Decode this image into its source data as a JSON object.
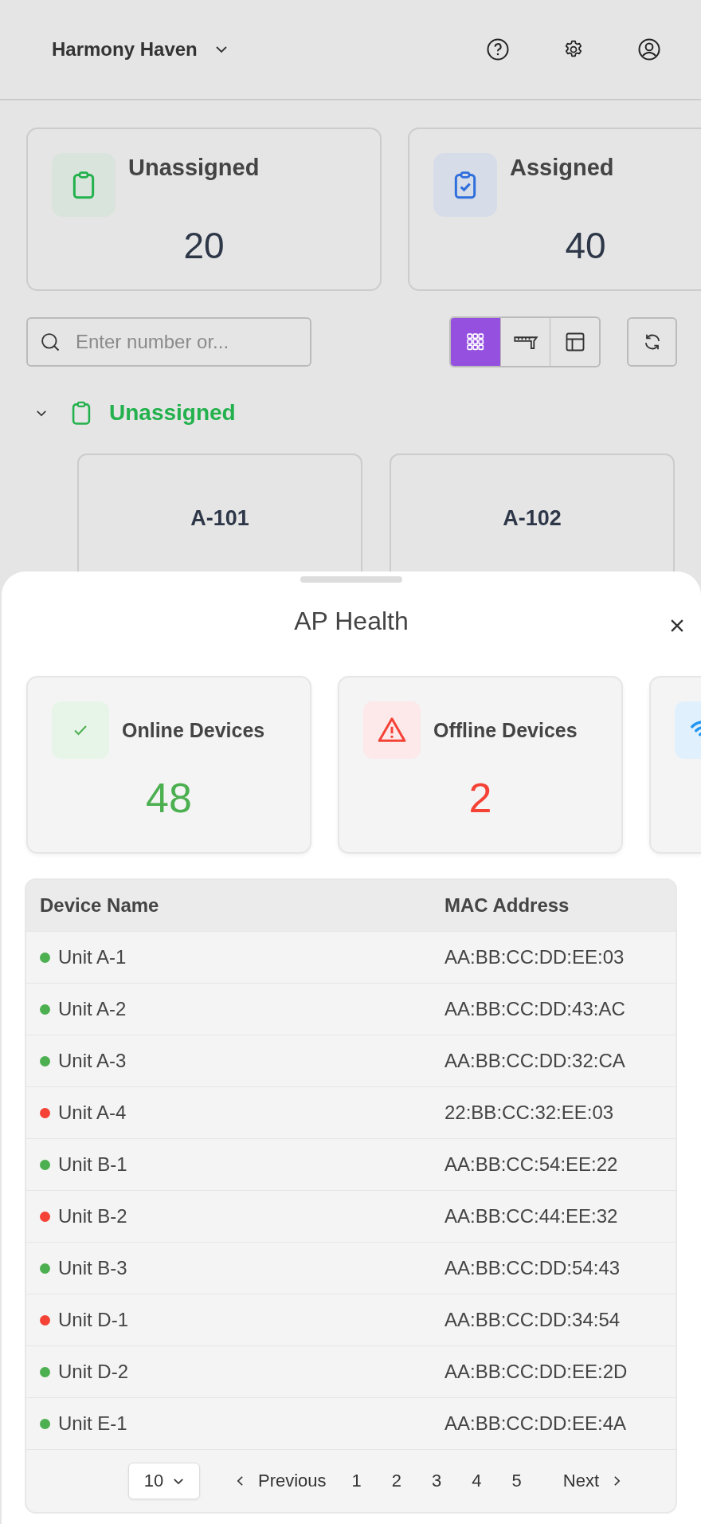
{
  "header": {
    "title": "Harmony Haven"
  },
  "summary_cards": [
    {
      "kind": "unassigned",
      "label": "Unassigned",
      "count": "20"
    },
    {
      "kind": "assigned",
      "label": "Assigned",
      "count": "40"
    }
  ],
  "search": {
    "placeholder": "Enter number or..."
  },
  "view_toggle": [
    {
      "kind": "grid",
      "selected": true
    },
    {
      "kind": "ruler",
      "selected": false
    },
    {
      "kind": "layout",
      "selected": false
    }
  ],
  "group": {
    "label": "Unassigned",
    "expanded": true,
    "units": [
      "A-101",
      "A-102"
    ]
  },
  "sheet": {
    "title": "AP Health",
    "health_cards": [
      {
        "kind": "online",
        "label": "Online Devices",
        "value": "48"
      },
      {
        "kind": "offline",
        "label": "Offline Devices",
        "value": "2"
      },
      {
        "kind": "wifi"
      }
    ],
    "table": {
      "columns": [
        "Device Name",
        "MAC Address"
      ],
      "rows": [
        {
          "name": "Unit A-1",
          "mac": "AA:BB:CC:DD:EE:03",
          "color": "#4caf50"
        },
        {
          "name": "Unit A-2",
          "mac": "AA:BB:CC:DD:43:AC",
          "color": "#4caf50"
        },
        {
          "name": "Unit A-3",
          "mac": "AA:BB:CC:DD:32:CA",
          "color": "#4caf50"
        },
        {
          "name": "Unit A-4",
          "mac": "22:BB:CC:32:EE:03",
          "color": "#f44336"
        },
        {
          "name": "Unit B-1",
          "mac": "AA:BB:CC:54:EE:22",
          "color": "#4caf50"
        },
        {
          "name": "Unit B-2",
          "mac": "AA:BB:CC:44:EE:32",
          "color": "#f44336"
        },
        {
          "name": "Unit B-3",
          "mac": "AA:BB:CC:DD:54:43",
          "color": "#4caf50"
        },
        {
          "name": "Unit D-1",
          "mac": "AA:BB:CC:DD:34:54",
          "color": "#f44336"
        },
        {
          "name": "Unit D-2",
          "mac": "AA:BB:CC:DD:EE:2D",
          "color": "#4caf50"
        },
        {
          "name": "Unit E-1",
          "mac": "AA:BB:CC:DD:EE:4A",
          "color": "#4caf50"
        }
      ]
    },
    "pagination": {
      "page_size": "10",
      "previous": "Previous",
      "pages": [
        "1",
        "2",
        "3",
        "4",
        "5"
      ],
      "next": "Next"
    }
  }
}
